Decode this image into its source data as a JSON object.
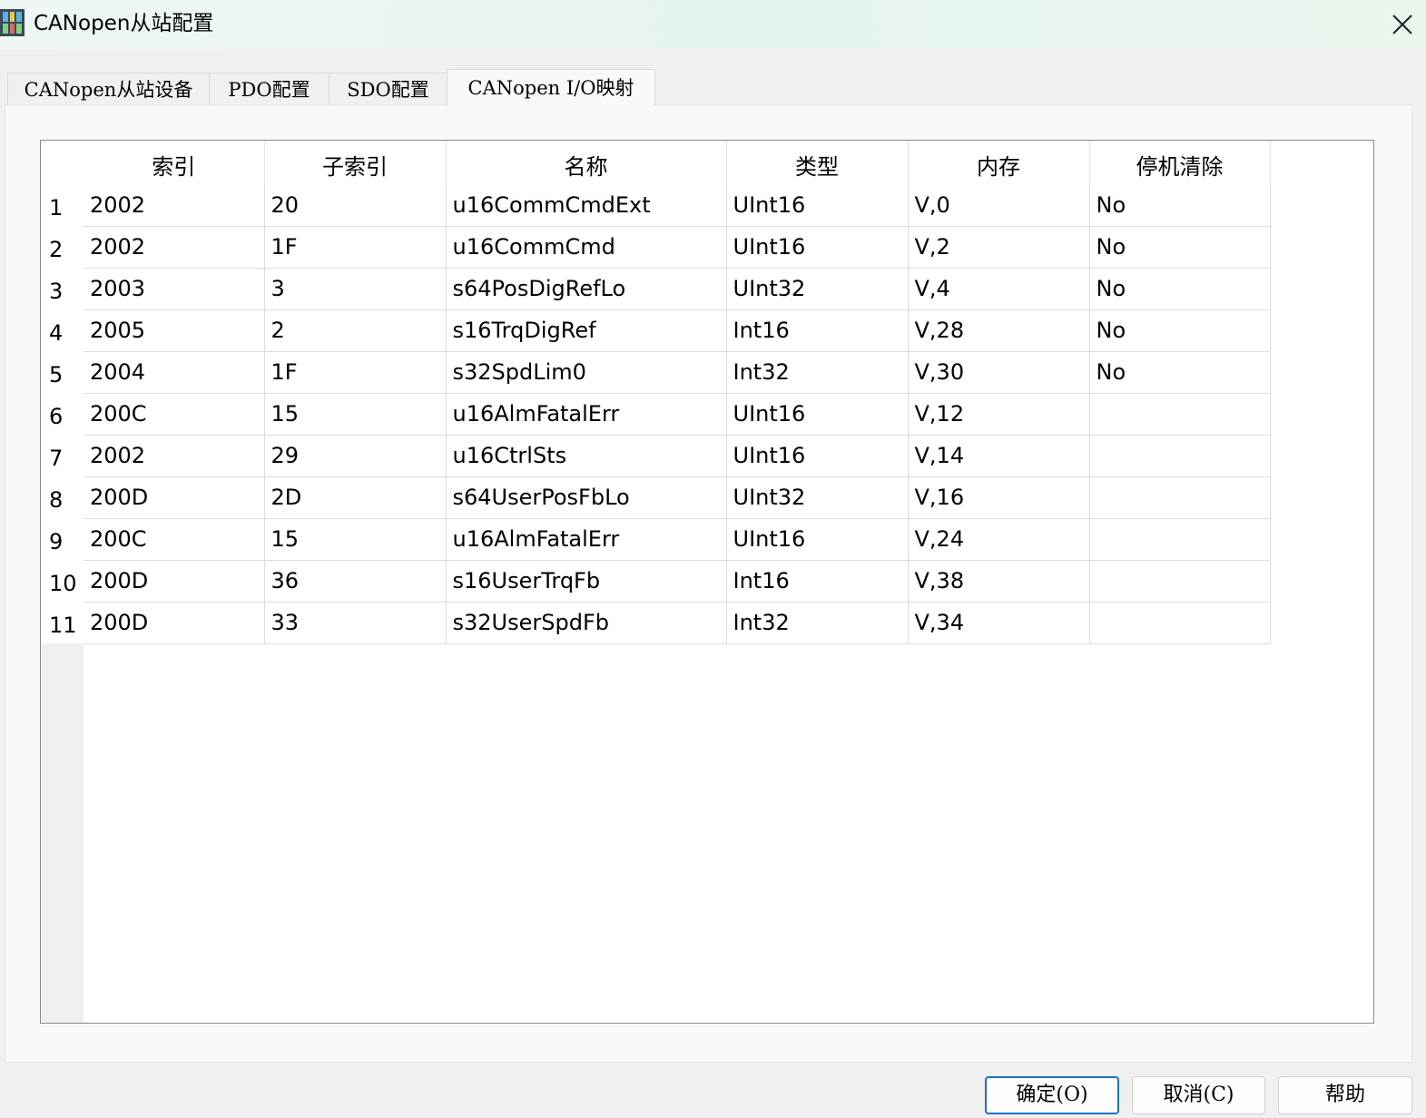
{
  "window": {
    "title": "CANopen从站配置"
  },
  "tabs": [
    {
      "label": "CANopen从站设备"
    },
    {
      "label": "PDO配置"
    },
    {
      "label": "SDO配置"
    },
    {
      "label": "CANopen I/O映射"
    }
  ],
  "table": {
    "columns": [
      "索引",
      "子索引",
      "名称",
      "类型",
      "内存",
      "停机清除"
    ],
    "rows": [
      {
        "num": "1",
        "cells": [
          "2002",
          "20",
          "u16CommCmdExt",
          "UInt16",
          "V,0",
          "No"
        ]
      },
      {
        "num": "2",
        "cells": [
          "2002",
          "1F",
          "u16CommCmd",
          "UInt16",
          "V,2",
          "No"
        ]
      },
      {
        "num": "3",
        "cells": [
          "2003",
          "3",
          "s64PosDigRefLo",
          "UInt32",
          "V,4",
          "No"
        ]
      },
      {
        "num": "4",
        "cells": [
          "2005",
          "2",
          "s16TrqDigRef",
          "Int16",
          "V,28",
          "No"
        ]
      },
      {
        "num": "5",
        "cells": [
          "2004",
          "1F",
          "s32SpdLim0",
          "Int32",
          "V,30",
          "No"
        ]
      },
      {
        "num": "6",
        "cells": [
          "200C",
          "15",
          "u16AlmFatalErr",
          "UInt16",
          "V,12",
          ""
        ]
      },
      {
        "num": "7",
        "cells": [
          "2002",
          "29",
          "u16CtrlSts",
          "UInt16",
          "V,14",
          ""
        ]
      },
      {
        "num": "8",
        "cells": [
          "200D",
          "2D",
          "s64UserPosFbLo",
          "UInt32",
          "V,16",
          ""
        ]
      },
      {
        "num": "9",
        "cells": [
          "200C",
          "15",
          "u16AlmFatalErr",
          "UInt16",
          "V,24",
          ""
        ]
      },
      {
        "num": "10",
        "cells": [
          "200D",
          "36",
          "s16UserTrqFb",
          "Int16",
          "V,38",
          ""
        ]
      },
      {
        "num": "11",
        "cells": [
          "200D",
          "33",
          "s32UserSpdFb",
          "Int32",
          "V,34",
          ""
        ]
      }
    ]
  },
  "buttons": {
    "ok": "确定(O)",
    "cancel": "取消(C)",
    "help": "帮助"
  },
  "icons": {
    "app": "app-icon",
    "close": "close-icon"
  }
}
